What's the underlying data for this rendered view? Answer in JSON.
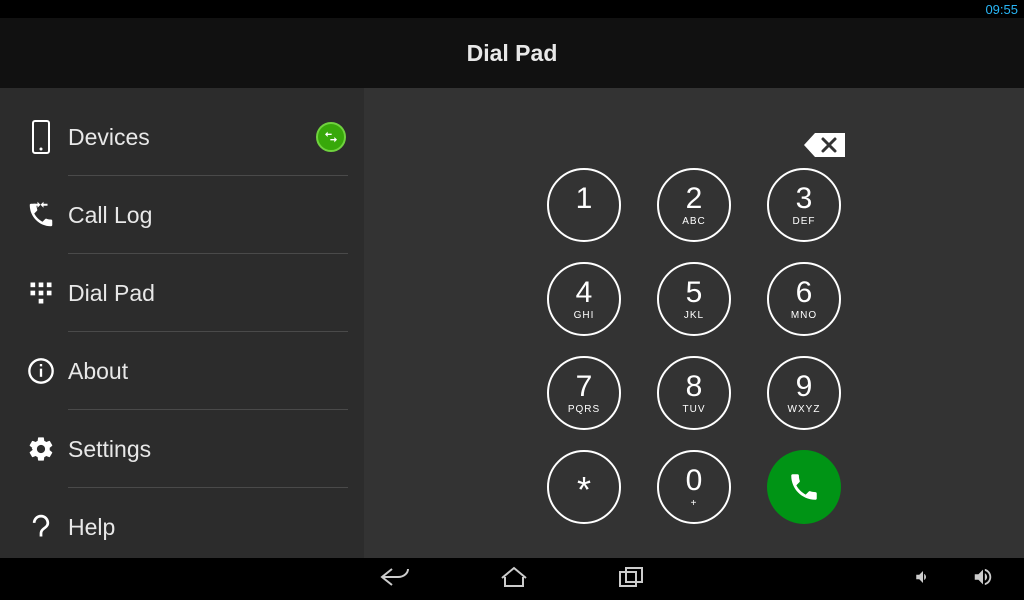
{
  "statusbar": {
    "time": "09:55"
  },
  "header": {
    "title": "Dial Pad"
  },
  "sidebar": {
    "items": [
      {
        "label": "Devices"
      },
      {
        "label": "Call Log"
      },
      {
        "label": "Dial Pad"
      },
      {
        "label": "About"
      },
      {
        "label": "Settings"
      },
      {
        "label": "Help"
      }
    ]
  },
  "dialpad": {
    "keys": [
      {
        "digit": "1",
        "letters": ""
      },
      {
        "digit": "2",
        "letters": "ABC"
      },
      {
        "digit": "3",
        "letters": "DEF"
      },
      {
        "digit": "4",
        "letters": "GHI"
      },
      {
        "digit": "5",
        "letters": "JKL"
      },
      {
        "digit": "6",
        "letters": "MNO"
      },
      {
        "digit": "7",
        "letters": "PQRS"
      },
      {
        "digit": "8",
        "letters": "TUV"
      },
      {
        "digit": "9",
        "letters": "WXYZ"
      },
      {
        "digit": "*",
        "letters": ""
      },
      {
        "digit": "0",
        "letters": "+"
      }
    ]
  }
}
